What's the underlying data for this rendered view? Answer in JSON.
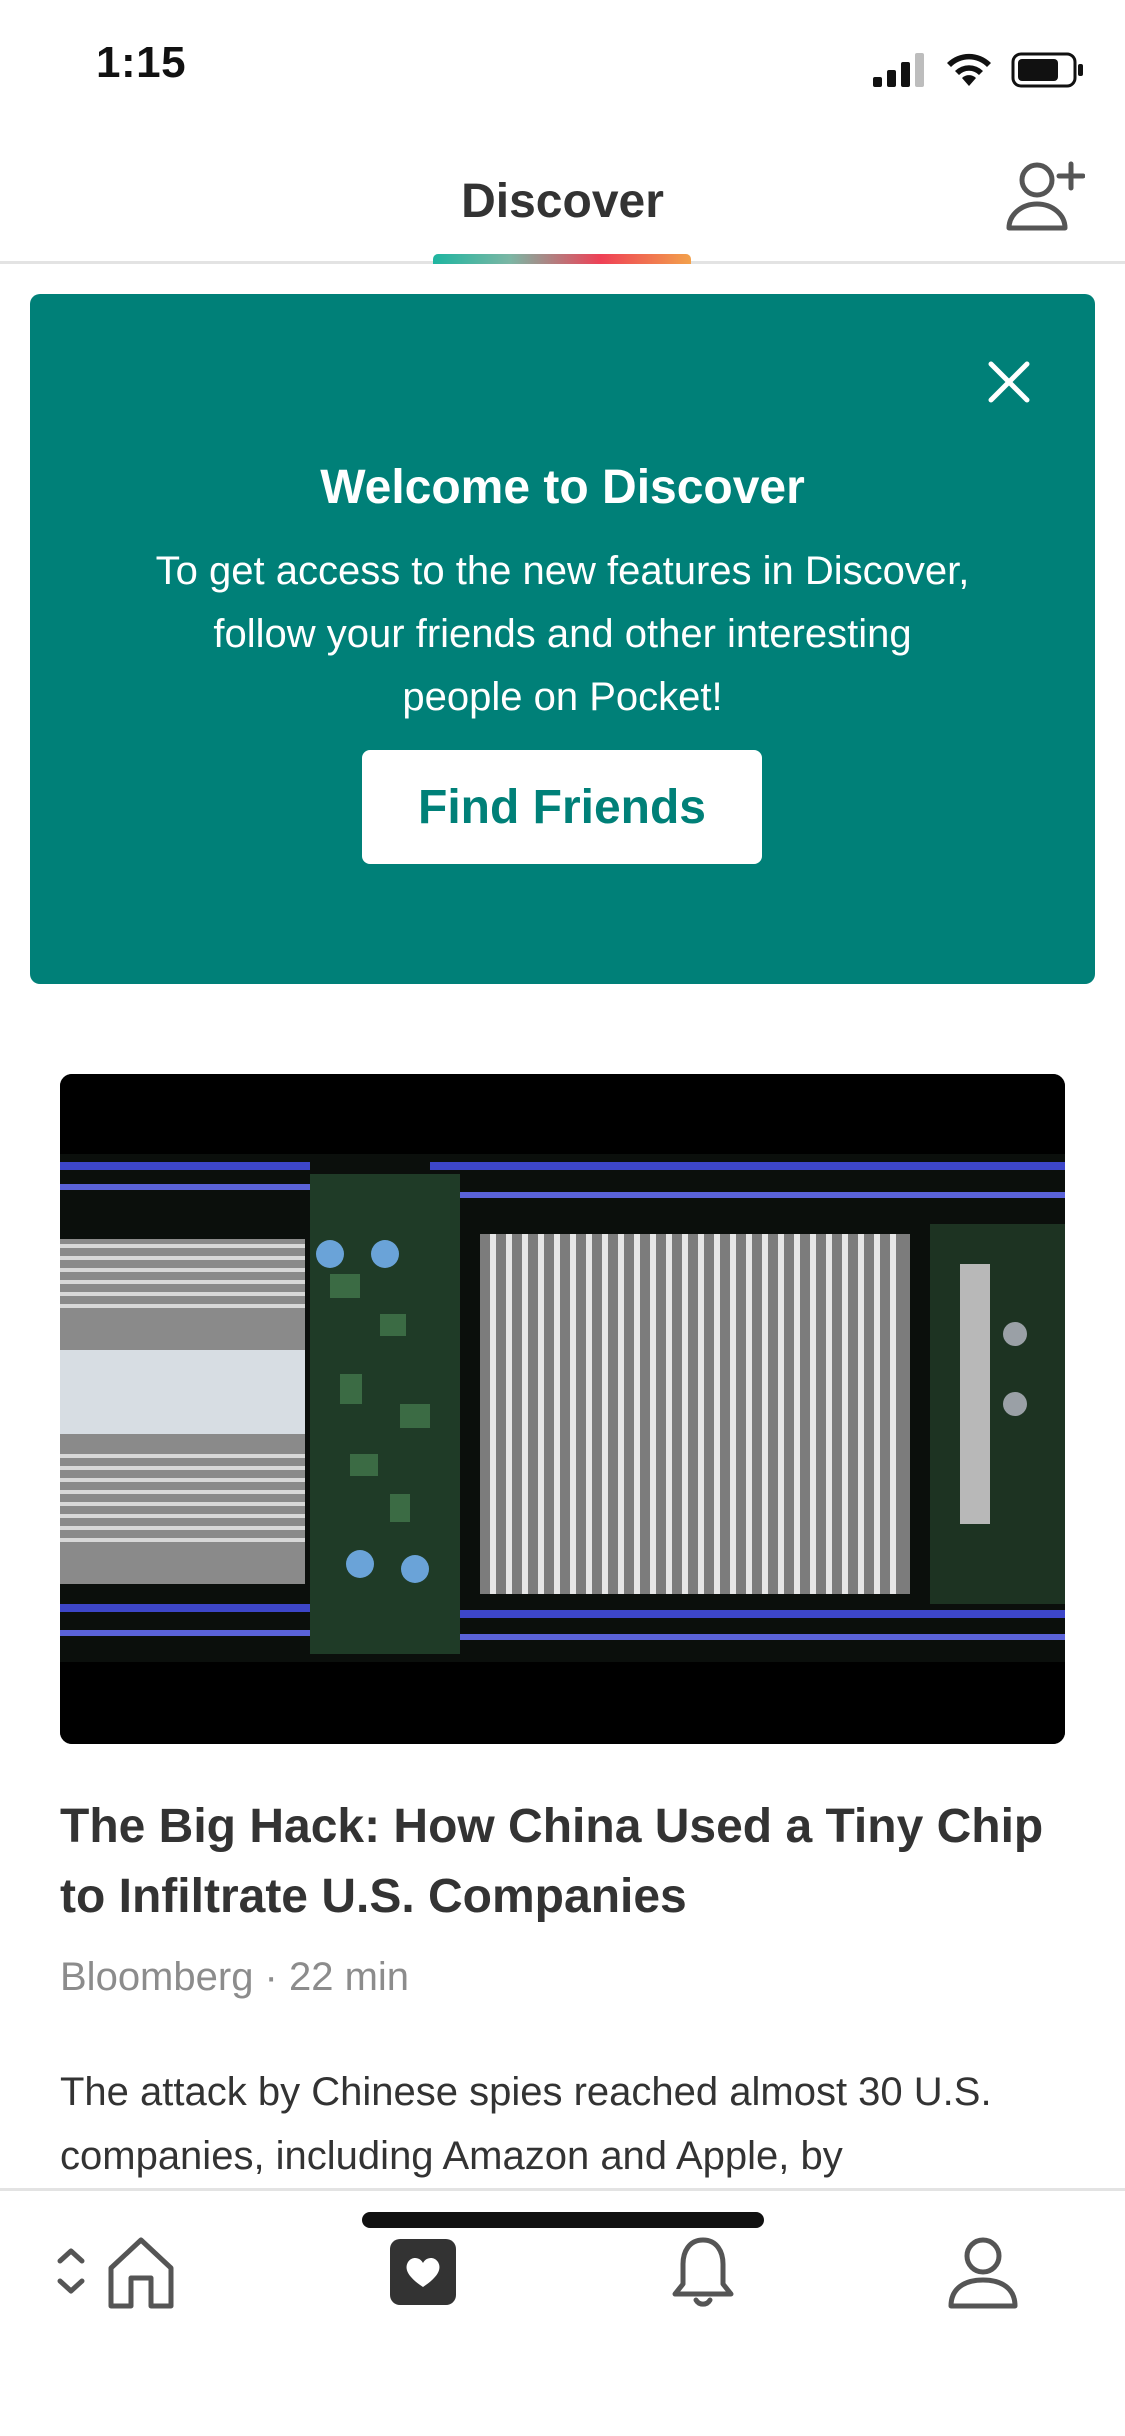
{
  "status_bar": {
    "time": "1:15"
  },
  "header": {
    "title": "Discover"
  },
  "welcome_card": {
    "title": "Welcome to Discover",
    "text": "To get access to the new features in Discover, follow your friends and other interesting people on Pocket!",
    "button_label": "Find Friends",
    "background_color": "#008078"
  },
  "article": {
    "title": "The Big Hack: How China Used a Tiny Chip to Infiltrate U.S. Companies",
    "meta": "Bloomberg · 22 min",
    "excerpt": "The attack by Chinese spies reached almost 30 U.S. companies, including Amazon and Apple, by"
  },
  "icons": {
    "status": [
      "signal-icon",
      "wifi-icon",
      "battery-icon"
    ],
    "header": [
      "add-friend-icon"
    ],
    "welcome": [
      "close-icon"
    ],
    "tabs": [
      "switch-chevrons-icon",
      "home-icon",
      "discover-heart-icon",
      "bell-icon",
      "profile-icon"
    ]
  }
}
